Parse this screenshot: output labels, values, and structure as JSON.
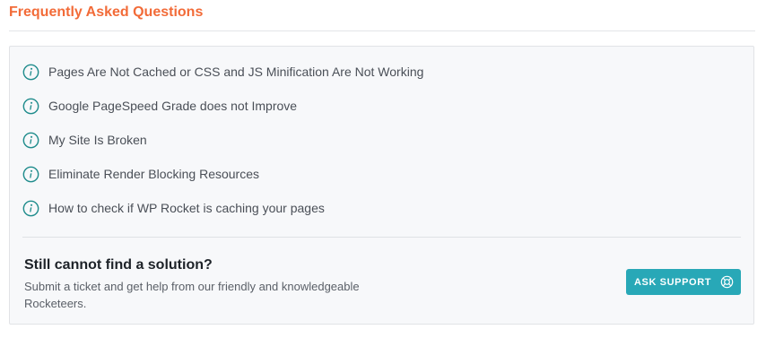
{
  "faq": {
    "title": "Frequently Asked Questions",
    "items": [
      {
        "label": "Pages Are Not Cached or CSS and JS Minification Are Not Working",
        "icon": "info-circle-icon"
      },
      {
        "label": "Google PageSpeed Grade does not Improve",
        "icon": "info-circle-icon"
      },
      {
        "label": "My Site Is Broken",
        "icon": "info-circle-icon"
      },
      {
        "label": "Eliminate Render Blocking Resources",
        "icon": "info-circle-icon"
      },
      {
        "label": "How to check if WP Rocket is caching your pages",
        "icon": "info-circle-icon"
      }
    ]
  },
  "support": {
    "title": "Still cannot find a solution?",
    "description": "Submit a ticket and get help from our friendly and knowledgeable Rocketeers.",
    "button_label": "ASK SUPPORT",
    "button_icon": "lifebuoy-icon"
  },
  "colors": {
    "title_accent": "#f26b38",
    "icon_teal": "#1f8c8c",
    "button_bg": "#28a8b7",
    "panel_bg": "#f7f8fa"
  }
}
